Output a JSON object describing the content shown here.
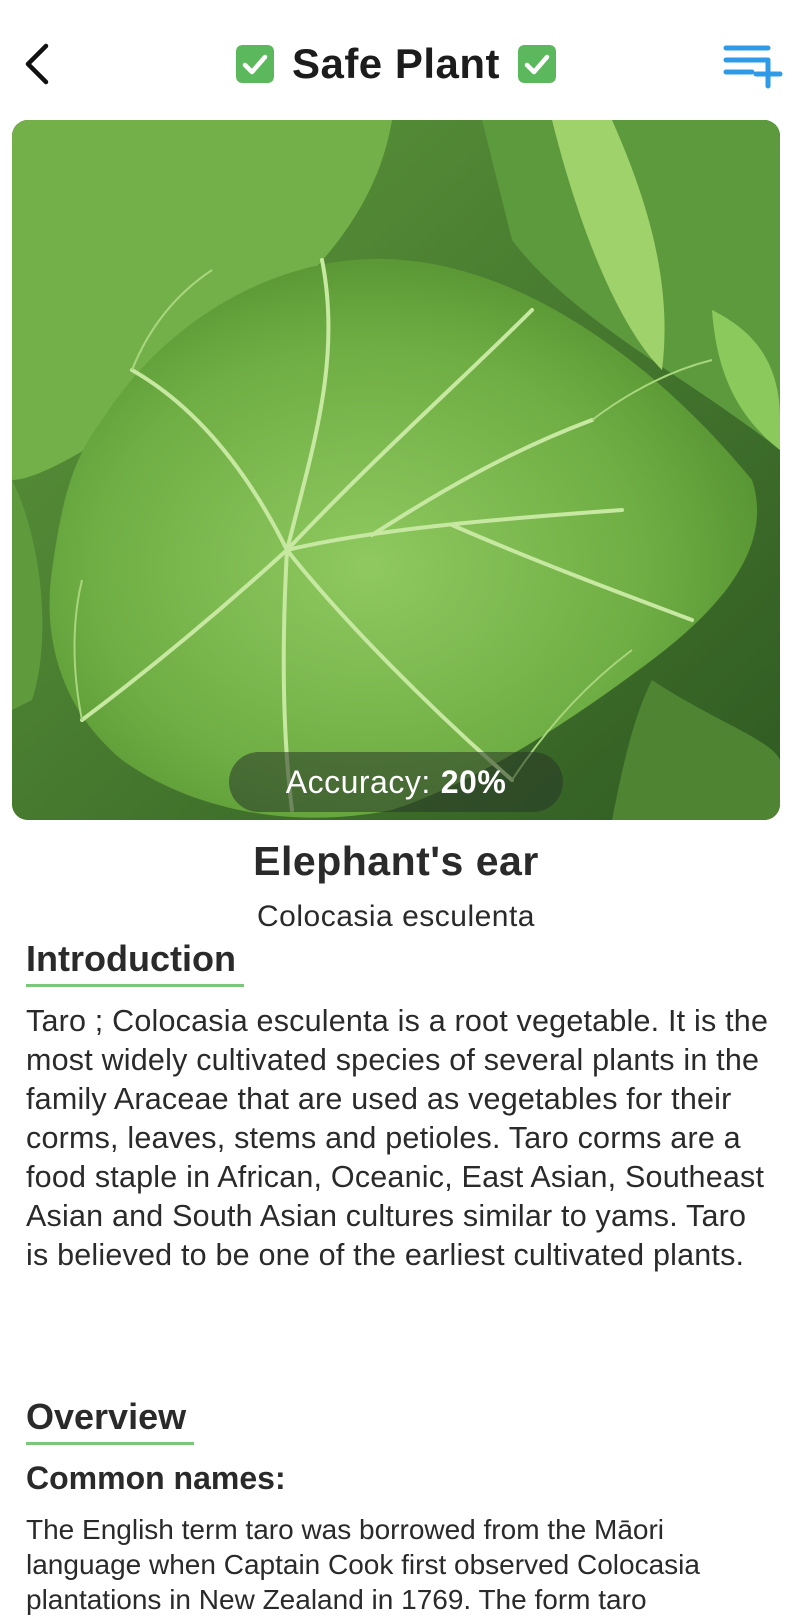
{
  "header": {
    "title": "Safe Plant",
    "back_icon": "chevron-left-icon",
    "add_icon": "playlist-add-icon",
    "check_icon": "check-box-icon",
    "check_color": "#5cb85c",
    "accent_color": "#2f9be6"
  },
  "hero": {
    "accuracy_label": "Accuracy:",
    "accuracy_value": "20%"
  },
  "plant": {
    "common_name": "Elephant's ear",
    "scientific_name": "Colocasia esculenta"
  },
  "introduction": {
    "heading": "Introduction",
    "text": "Taro ; Colocasia esculenta is a root vegetable. It is the most widely cultivated species of several plants in the family Araceae that are used as vegetables for their corms, leaves, stems and petioles. Taro corms are a food staple in African, Oceanic, East Asian, Southeast Asian and South Asian cultures similar to yams. Taro is believed to be one of the earliest cultivated plants."
  },
  "overview": {
    "heading": "Overview",
    "common_names_label": "Common names:",
    "common_names_text": "The English term taro was borrowed from the Māori language when Captain Cook first observed Colocasia plantations in New Zealand in 1769. The form taro"
  }
}
